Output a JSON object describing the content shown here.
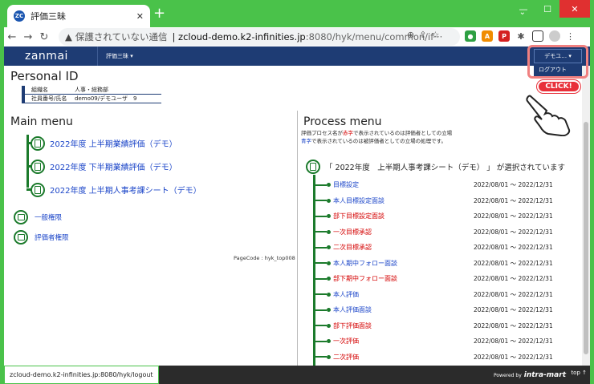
{
  "browser": {
    "tab_title": "評価三昧",
    "favicon_text": "ZC",
    "security_label": "保護されていない通信",
    "url_host": "zcloud-demo.k2-infinities.jp",
    "url_rest": ":8080/hyk/menu/common/if···",
    "status_url": "zcloud-demo.k2-infinities.jp:8080/hyk/logout"
  },
  "header": {
    "logo": "zanmai",
    "app_menu": "評価三昧 ▾",
    "user_button": "デモユ… ▾",
    "dropdown_logout": "ログアウト"
  },
  "callout": {
    "click": "CLICK!"
  },
  "personal": {
    "title": "Personal ID",
    "rows": [
      {
        "key": "組織名",
        "value": "人事・総務部"
      },
      {
        "key": "社員番号/氏名",
        "value": "demo09/デモユーザ　9"
      }
    ]
  },
  "main_menu": {
    "title": "Main menu",
    "items": [
      "2022年度 上半期業績評価（デモ）",
      "2022年度 下半期業績評価（デモ）",
      "2022年度 上半期人事考課シート（デモ）"
    ],
    "auth_items": [
      "一般権限",
      "評価者権限"
    ],
    "page_code": "PageCode : hyk_top008"
  },
  "process_menu": {
    "title": "Process menu",
    "desc1_pre": "評価プロセス名が",
    "desc1_red": "赤字",
    "desc1_post": "で表示されているのは評価者としての立場",
    "desc2_blue": "青字",
    "desc2_post": "で表示されているのは被評価者としての立場の処理です。",
    "selected": "「 2022年度　上半期人事考課シート（デモ） 」 が選択されています",
    "items": [
      {
        "label": "目標設定",
        "color": "blue",
        "date": "2022/08/01 ～ 2022/12/31"
      },
      {
        "label": "本人目標設定面談",
        "color": "blue",
        "date": "2022/08/01 ～ 2022/12/31"
      },
      {
        "label": "部下目標設定面談",
        "color": "red",
        "date": "2022/08/01 ～ 2022/12/31"
      },
      {
        "label": "一次目標承認",
        "color": "red",
        "date": "2022/08/01 ～ 2022/12/31"
      },
      {
        "label": "二次目標承認",
        "color": "red",
        "date": "2022/08/01 ～ 2022/12/31"
      },
      {
        "label": "本人期中フォロー面談",
        "color": "blue",
        "date": "2022/08/01 ～ 2022/12/31"
      },
      {
        "label": "部下期中フォロー面談",
        "color": "red",
        "date": "2022/08/01 ～ 2022/12/31"
      },
      {
        "label": "本人評価",
        "color": "blue",
        "date": "2022/08/01 ～ 2022/12/31"
      },
      {
        "label": "本人評価面談",
        "color": "blue",
        "date": "2022/08/01 ～ 2022/12/31"
      },
      {
        "label": "部下評価面談",
        "color": "red",
        "date": "2022/08/01 ～ 2022/12/31"
      },
      {
        "label": "一次評価",
        "color": "red",
        "date": "2022/08/01 ～ 2022/12/31"
      },
      {
        "label": "二次評価",
        "color": "red",
        "date": "2022/08/01 ～ 2022/12/31"
      }
    ]
  },
  "footer": {
    "powered": "Powered by",
    "brand": "intra-mart",
    "top": "top ↑"
  }
}
